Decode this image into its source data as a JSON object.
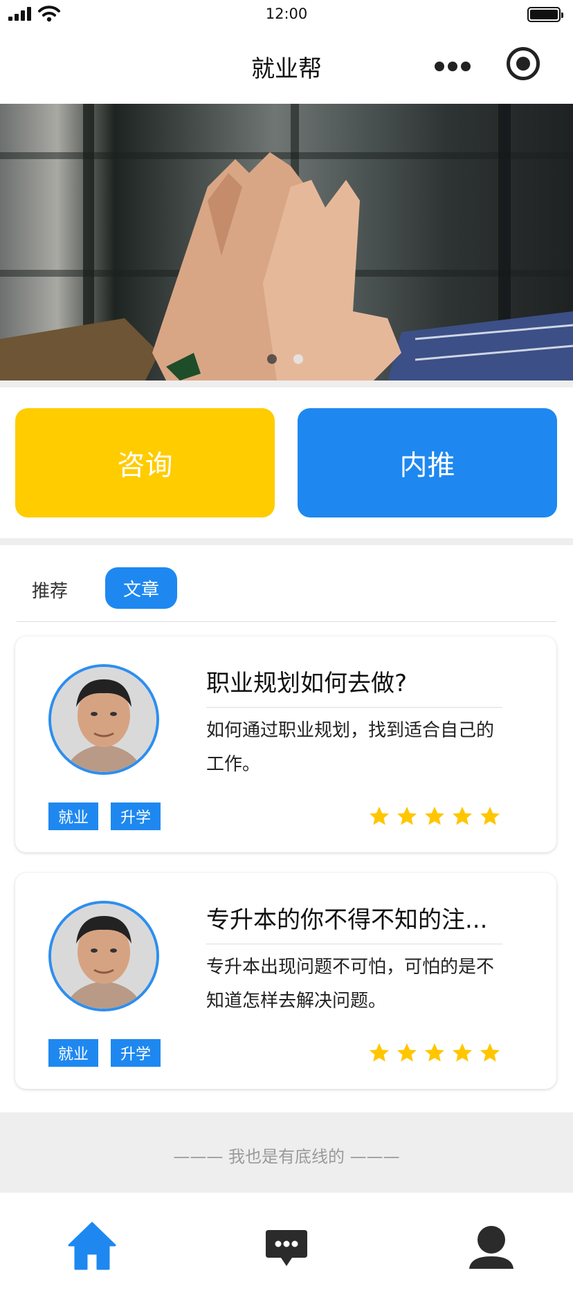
{
  "status_bar": {
    "time": "12:00"
  },
  "nav": {
    "title": "就业帮",
    "more_icon": "more-dots-icon",
    "capsule_icon": "target-icon"
  },
  "banner": {
    "image": "high-five-hands-photo",
    "slides": 2,
    "active_slide": 1
  },
  "actions": [
    {
      "label": "咨询",
      "color": "#ffcc00"
    },
    {
      "label": "内推",
      "color": "#1e88f0"
    }
  ],
  "tabs": [
    {
      "label": "推荐",
      "active": false
    },
    {
      "label": "文章",
      "active": true
    }
  ],
  "articles": [
    {
      "title": "职业规划如何去做?",
      "desc": "如何通过职业规划，找到适合自己的工作。",
      "tags": [
        "就业",
        "升学"
      ],
      "rating": 5
    },
    {
      "title": "专升本的你不得不知的注...",
      "desc": "专升本出现问题不可怕，可怕的是不知道怎样去解决问题。",
      "tags": [
        "就业",
        "升学"
      ],
      "rating": 5
    }
  ],
  "footer": {
    "text": "——— 我也是有底线的 ———"
  },
  "tabbar": [
    {
      "icon": "home-icon",
      "active": true
    },
    {
      "icon": "message-icon",
      "active": false
    },
    {
      "icon": "user-icon",
      "active": false
    }
  ],
  "colors": {
    "accent": "#1e88f0",
    "yellow": "#ffcc00",
    "star": "#ffc600"
  }
}
